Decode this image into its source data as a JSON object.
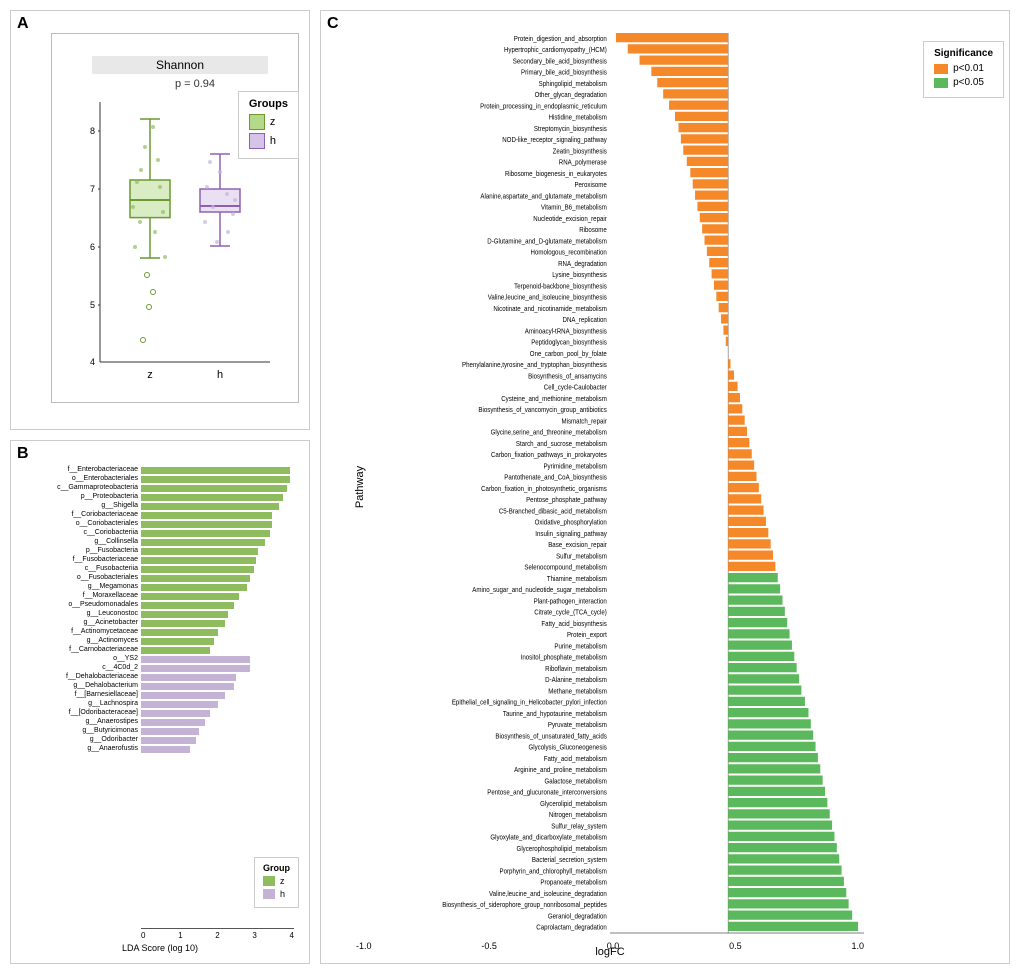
{
  "panels": {
    "a": {
      "label": "A",
      "title": "Shannon",
      "pvalue": "p = 0.94",
      "y_axis": [
        "4",
        "5",
        "6",
        "7",
        "8"
      ],
      "x_axis": [
        "z",
        "h"
      ],
      "legend": {
        "title": "Groups",
        "items": [
          {
            "label": "z",
            "color": "#8fbc5f"
          },
          {
            "label": "h",
            "color": "#c4b3d4"
          }
        ]
      }
    },
    "b": {
      "label": "B",
      "x_axis_title": "LDA Score (log 10)",
      "x_ticks": [
        "0",
        "1",
        "2",
        "3",
        "4"
      ],
      "legend": {
        "title": "Group",
        "items": [
          {
            "label": "z",
            "color": "#8fbc5f"
          },
          {
            "label": "h",
            "color": "#c4b3d4"
          }
        ]
      },
      "bars": [
        {
          "label": "f__Enterobacteriaceae",
          "value": 4.1,
          "group": "z"
        },
        {
          "label": "o__Enterobacteriales",
          "value": 4.1,
          "group": "z"
        },
        {
          "label": "c__Gammaproteobacteria",
          "value": 4.0,
          "group": "z"
        },
        {
          "label": "p__Proteobacteria",
          "value": 3.9,
          "group": "z"
        },
        {
          "label": "g__Shigella",
          "value": 3.8,
          "group": "z"
        },
        {
          "label": "f__Coriobacteriaceae",
          "value": 3.6,
          "group": "z"
        },
        {
          "label": "o__Coriobacteriales",
          "value": 3.6,
          "group": "z"
        },
        {
          "label": "c__Coriobacteriia",
          "value": 3.55,
          "group": "z"
        },
        {
          "label": "g__Collinsella",
          "value": 3.4,
          "group": "z"
        },
        {
          "label": "p__Fusobacteria",
          "value": 3.2,
          "group": "z"
        },
        {
          "label": "f__Fusobacteriaceae",
          "value": 3.15,
          "group": "z"
        },
        {
          "label": "c__Fusobacteriia",
          "value": 3.1,
          "group": "z"
        },
        {
          "label": "o__Fusobacteriales",
          "value": 3.0,
          "group": "z"
        },
        {
          "label": "g__Megamonas",
          "value": 2.9,
          "group": "z"
        },
        {
          "label": "f__Moraxellaceae",
          "value": 2.7,
          "group": "z"
        },
        {
          "label": "o__Pseudomonadales",
          "value": 2.55,
          "group": "z"
        },
        {
          "label": "g__Leuconostoc",
          "value": 2.4,
          "group": "z"
        },
        {
          "label": "g__Acinetobacter",
          "value": 2.3,
          "group": "z"
        },
        {
          "label": "f__Actinomycetaceae",
          "value": 2.1,
          "group": "z"
        },
        {
          "label": "g__Actinomyces",
          "value": 2.0,
          "group": "z"
        },
        {
          "label": "f__Carnobacteriaceae",
          "value": 1.9,
          "group": "z"
        },
        {
          "label": "o__YS2",
          "value": 3.0,
          "group": "h"
        },
        {
          "label": "c__4C0d_2",
          "value": 3.0,
          "group": "h"
        },
        {
          "label": "f__Dehalobacteriaceae",
          "value": 2.6,
          "group": "h"
        },
        {
          "label": "g__Dehalobacterium",
          "value": 2.55,
          "group": "h"
        },
        {
          "label": "f__[Barnesiellaceae]",
          "value": 2.3,
          "group": "h"
        },
        {
          "label": "g__Lachnospira",
          "value": 2.1,
          "group": "h"
        },
        {
          "label": "f__[Odoribacteraceae]",
          "value": 1.9,
          "group": "h"
        },
        {
          "label": "g__Anaerostipes",
          "value": 1.75,
          "group": "h"
        },
        {
          "label": "g__Butyricimonas",
          "value": 1.6,
          "group": "h"
        },
        {
          "label": "g__Odoribacter",
          "value": 1.5,
          "group": "h"
        },
        {
          "label": "g__Anaerofustis",
          "value": 1.35,
          "group": "h"
        }
      ]
    },
    "c": {
      "label": "C",
      "x_axis_title": "logFC",
      "x_ticks": [
        "-1.0",
        "-0.5",
        "0.0",
        "0.5",
        "1.0"
      ],
      "y_axis_title": "Pathway",
      "legend": {
        "title": "Significance",
        "items": [
          {
            "label": "p<0.01",
            "color": "#f5892a"
          },
          {
            "label": "p<0.05",
            "color": "#5cb85c"
          }
        ]
      },
      "bars": [
        {
          "label": "Protein_digestion_and_absorption",
          "value": -0.95,
          "sig": "p<0.01"
        },
        {
          "label": "Hypertrophic_cardiomyopathy_(HCM)",
          "value": -0.85,
          "sig": "p<0.01"
        },
        {
          "label": "Secondary_bile_acid_biosynthesis",
          "value": -0.75,
          "sig": "p<0.01"
        },
        {
          "label": "Primary_bile_acid_biosynthesis",
          "value": -0.65,
          "sig": "p<0.01"
        },
        {
          "label": "Sphingolipid_metabolism",
          "value": -0.6,
          "sig": "p<0.01"
        },
        {
          "label": "Other_glycan_degradation",
          "value": -0.55,
          "sig": "p<0.01"
        },
        {
          "label": "Protein_processing_in_endoplasmic_reticulum",
          "value": -0.5,
          "sig": "p<0.01"
        },
        {
          "label": "Histidine_metabolism",
          "value": -0.45,
          "sig": "p<0.01"
        },
        {
          "label": "Streptomycin_biosynthesis",
          "value": -0.42,
          "sig": "p<0.01"
        },
        {
          "label": "NOD-like_receptor_signaling_pathway",
          "value": -0.4,
          "sig": "p<0.01"
        },
        {
          "label": "Zeatin_biosynthesis",
          "value": -0.38,
          "sig": "p<0.01"
        },
        {
          "label": "RNA_polymerase",
          "value": -0.35,
          "sig": "p<0.01"
        },
        {
          "label": "Ribosome_biogenesis_in_eukaryotes",
          "value": -0.32,
          "sig": "p<0.01"
        },
        {
          "label": "Peroxisome",
          "value": -0.3,
          "sig": "p<0.01"
        },
        {
          "label": "Alanine,aspartate_and_glutamate_metabolism",
          "value": -0.28,
          "sig": "p<0.01"
        },
        {
          "label": "Vitamin_B6_metabolism",
          "value": -0.26,
          "sig": "p<0.01"
        },
        {
          "label": "Nucleotide_excision_repair",
          "value": -0.24,
          "sig": "p<0.01"
        },
        {
          "label": "Ribosome",
          "value": -0.22,
          "sig": "p<0.01"
        },
        {
          "label": "D-Glutamine_and_D-glutamate_metabolism",
          "value": -0.2,
          "sig": "p<0.01"
        },
        {
          "label": "Homologous_recombination",
          "value": -0.18,
          "sig": "p<0.01"
        },
        {
          "label": "RNA_degradation",
          "value": -0.16,
          "sig": "p<0.01"
        },
        {
          "label": "Lysine_biosynthesis",
          "value": -0.14,
          "sig": "p<0.01"
        },
        {
          "label": "Terpenoid-backbone_biosynthesis",
          "value": -0.12,
          "sig": "p<0.01"
        },
        {
          "label": "Valine,leucine_and_isoleucine_biosynthesis",
          "value": -0.1,
          "sig": "p<0.01"
        },
        {
          "label": "Nicotinate_and_nicotinamide_metabolism",
          "value": -0.08,
          "sig": "p<0.01"
        },
        {
          "label": "DNA_replication",
          "value": -0.06,
          "sig": "p<0.01"
        },
        {
          "label": "Aminoacyl-tRNA_biosynthesis",
          "value": -0.04,
          "sig": "p<0.01"
        },
        {
          "label": "Peptidoglycan_biosynthesis",
          "value": -0.02,
          "sig": "p<0.01"
        },
        {
          "label": "One_carbon_pool_by_folate",
          "value": 0.0,
          "sig": "p<0.01"
        },
        {
          "label": "Phenylalanine,tyrosine_and_tryptophan_biosynthesis",
          "value": 0.02,
          "sig": "p<0.01"
        },
        {
          "label": "Biosynthesis_of_ansamycins",
          "value": 0.05,
          "sig": "p<0.01"
        },
        {
          "label": "Cell_cycle-Caulobacter",
          "value": 0.08,
          "sig": "p<0.01"
        },
        {
          "label": "Cysteine_and_methionine_metabolism",
          "value": 0.1,
          "sig": "p<0.01"
        },
        {
          "label": "Biosynthesis_of_vancomycin_group_antibiotics",
          "value": 0.12,
          "sig": "p<0.01"
        },
        {
          "label": "Mismatch_repair",
          "value": 0.14,
          "sig": "p<0.01"
        },
        {
          "label": "Glycine,serine_and_threonine_metabolism",
          "value": 0.16,
          "sig": "p<0.01"
        },
        {
          "label": "Starch_and_sucrose_metabolism",
          "value": 0.18,
          "sig": "p<0.01"
        },
        {
          "label": "Carbon_fixation_pathways_in_prokaryotes",
          "value": 0.2,
          "sig": "p<0.01"
        },
        {
          "label": "Pyrimidine_metabolism",
          "value": 0.22,
          "sig": "p<0.01"
        },
        {
          "label": "Pantothenate_and_CoA_biosynthesis",
          "value": 0.24,
          "sig": "p<0.01"
        },
        {
          "label": "Carbon_fixation_in_photosynthetic_organisms",
          "value": 0.26,
          "sig": "p<0.01"
        },
        {
          "label": "Pentose_phosphate_pathway",
          "value": 0.28,
          "sig": "p<0.01"
        },
        {
          "label": "C5-Branched_dibasic_acid_metabolism",
          "value": 0.3,
          "sig": "p<0.01"
        },
        {
          "label": "Oxidative_phosphorylation",
          "value": 0.32,
          "sig": "p<0.01"
        },
        {
          "label": "Insulin_signaling_pathway",
          "value": 0.34,
          "sig": "p<0.01"
        },
        {
          "label": "Base_excision_repair",
          "value": 0.36,
          "sig": "p<0.01"
        },
        {
          "label": "Sulfur_metabolism",
          "value": 0.38,
          "sig": "p<0.01"
        },
        {
          "label": "Selenocompound_metabolism",
          "value": 0.4,
          "sig": "p<0.01"
        },
        {
          "label": "Thiamine_metabolism",
          "value": 0.42,
          "sig": "p<0.05"
        },
        {
          "label": "Amino_sugar_and_nucleotide_sugar_metabolism",
          "value": 0.44,
          "sig": "p<0.05"
        },
        {
          "label": "Plant-pathogen_interaction",
          "value": 0.46,
          "sig": "p<0.05"
        },
        {
          "label": "Citrate_cycle_(TCA_cycle)",
          "value": 0.48,
          "sig": "p<0.05"
        },
        {
          "label": "Fatty_acid_biosynthesis",
          "value": 0.5,
          "sig": "p<0.05"
        },
        {
          "label": "Protein_export",
          "value": 0.52,
          "sig": "p<0.05"
        },
        {
          "label": "Purine_metabolism",
          "value": 0.54,
          "sig": "p<0.05"
        },
        {
          "label": "Inositol_phosphate_metabolism",
          "value": 0.56,
          "sig": "p<0.05"
        },
        {
          "label": "Riboflavin_metabolism",
          "value": 0.58,
          "sig": "p<0.05"
        },
        {
          "label": "D-Alanine_metabolism",
          "value": 0.6,
          "sig": "p<0.05"
        },
        {
          "label": "Methane_metabolism",
          "value": 0.62,
          "sig": "p<0.05"
        },
        {
          "label": "Epithelial_cell_signaling_in_Helicobacter_pylori_infection",
          "value": 0.65,
          "sig": "p<0.05"
        },
        {
          "label": "Taurine_and_hypotaurine_metabolism",
          "value": 0.68,
          "sig": "p<0.05"
        },
        {
          "label": "Pyruvate_metabolism",
          "value": 0.7,
          "sig": "p<0.05"
        },
        {
          "label": "Biosynthesis_of_unsaturated_fatty_acids",
          "value": 0.72,
          "sig": "p<0.05"
        },
        {
          "label": "Glycolysis_Gluconeogenesis",
          "value": 0.74,
          "sig": "p<0.05"
        },
        {
          "label": "Fatty_acid_metabolism",
          "value": 0.76,
          "sig": "p<0.05"
        },
        {
          "label": "Arginine_and_proline_metabolism",
          "value": 0.78,
          "sig": "p<0.05"
        },
        {
          "label": "Galactose_metabolism",
          "value": 0.8,
          "sig": "p<0.05"
        },
        {
          "label": "Pentose_and_glucuronate_interconversions",
          "value": 0.82,
          "sig": "p<0.05"
        },
        {
          "label": "Glycerolipid_metabolism",
          "value": 0.84,
          "sig": "p<0.05"
        },
        {
          "label": "Nitrogen_metabolism",
          "value": 0.86,
          "sig": "p<0.05"
        },
        {
          "label": "Sulfur_relay_system",
          "value": 0.88,
          "sig": "p<0.05"
        },
        {
          "label": "Glyoxylate_and_dicarboxylate_metabolism",
          "value": 0.9,
          "sig": "p<0.05"
        },
        {
          "label": "Glycerophospholipid_metabolism",
          "value": 0.92,
          "sig": "p<0.05"
        },
        {
          "label": "Bacterial_secretion_system",
          "value": 0.94,
          "sig": "p<0.05"
        },
        {
          "label": "Porphyrin_and_chlorophyll_metabolism",
          "value": 0.96,
          "sig": "p<0.05"
        },
        {
          "label": "Propanoate_metabolism",
          "value": 0.98,
          "sig": "p<0.05"
        },
        {
          "label": "Valine,leucine_and_isoleucine_degradation",
          "value": 1.0,
          "sig": "p<0.05"
        },
        {
          "label": "Biosynthesis_of_siderophore_group_nonribosomal_peptides",
          "value": 1.02,
          "sig": "p<0.05"
        },
        {
          "label": "Geraniol_degradation",
          "value": 1.05,
          "sig": "p<0.05"
        },
        {
          "label": "Caprolactam_degradation",
          "value": 1.1,
          "sig": "p<0.05"
        }
      ]
    }
  },
  "colors": {
    "green": "#8fbc5f",
    "purple": "#c4b3d4",
    "orange": "#f5892a",
    "lime": "#5cb85c"
  }
}
